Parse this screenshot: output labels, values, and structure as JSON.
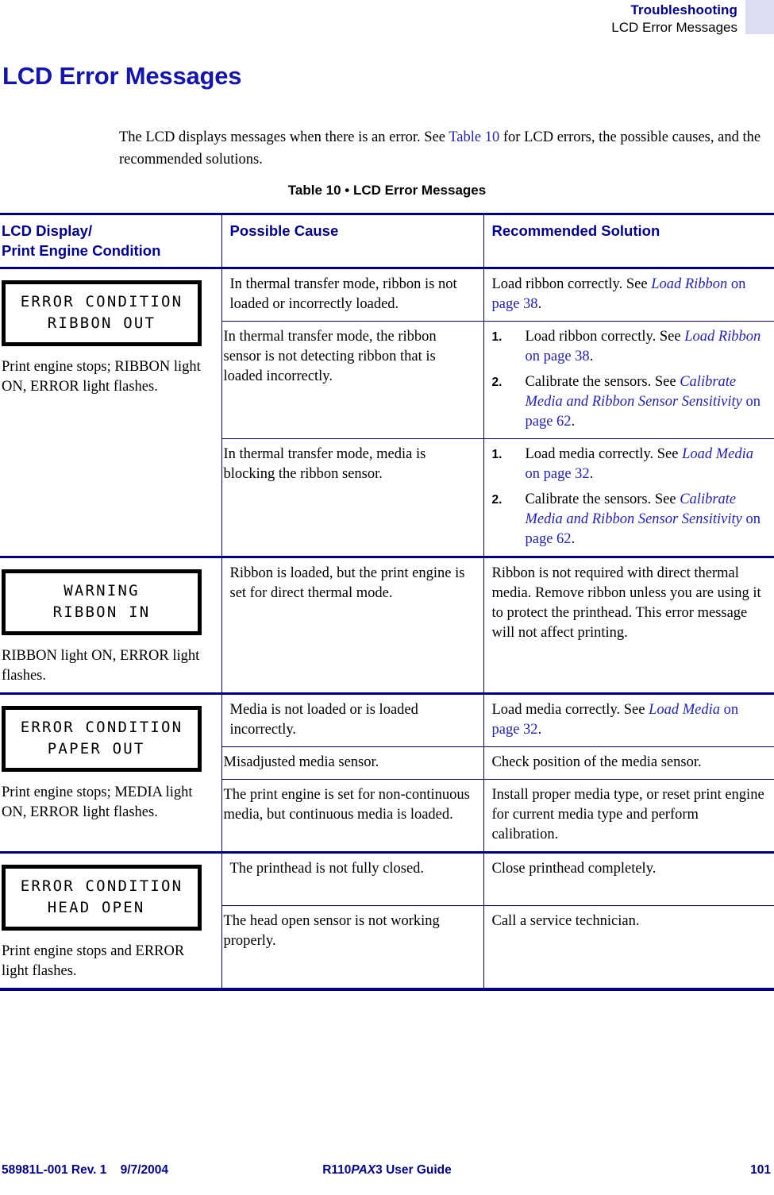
{
  "header": {
    "chapter": "Troubleshooting",
    "section": "LCD Error Messages",
    "swatch_color": "#dcdcf5"
  },
  "title": "LCD Error Messages",
  "intro": {
    "part1": "The LCD displays messages when there is an error. See ",
    "link": "Table 10",
    "part2": " for LCD errors, the possible causes, and the recommended solutions."
  },
  "table": {
    "caption": "Table 10 • LCD Error Messages",
    "columns": [
      "LCD Display/\nPrint Engine Condition",
      "Possible Cause",
      "Recommended Solution"
    ],
    "col_header_line1": "LCD Display/",
    "col_header_line2": "Print Engine Condition",
    "col_header_2": "Possible Cause",
    "col_header_3": "Recommended Solution",
    "groups": [
      {
        "lcd_line1": "ERROR CONDITION",
        "lcd_line2": "  RIBBON OUT  ",
        "condition": "Print engine stops; RIBBON light ON, ERROR light flashes.",
        "rows": [
          {
            "cause": "In thermal transfer mode, ribbon is not loaded or incorrectly loaded.",
            "solution_kind": "text",
            "solution_pre": "Load ribbon correctly. See ",
            "solution_link_italic": "Load Ribbon",
            "solution_link_page": " on page 38",
            "solution_post": "."
          },
          {
            "cause": "In thermal transfer mode, the ribbon sensor is not detecting ribbon that is loaded incorrectly.",
            "solution_kind": "steps",
            "steps": [
              {
                "pre": "Load ribbon correctly. See ",
                "link_italic": "Load Ribbon",
                "link_page": " on page 38",
                "post": "."
              },
              {
                "pre": "Calibrate the sensors. See ",
                "link_italic": "Calibrate Media and Ribbon Sensor Sensitivity",
                "link_page": " on page 62",
                "post": "."
              }
            ]
          },
          {
            "cause": "In thermal transfer mode, media is blocking the ribbon sensor.",
            "solution_kind": "steps",
            "steps": [
              {
                "pre": "Load media correctly. See ",
                "link_italic": "Load Media",
                "link_page": " on page 32",
                "post": "."
              },
              {
                "pre": "Calibrate the sensors. See ",
                "link_italic": "Calibrate Media and Ribbon Sensor Sensitivity",
                "link_page": " on page 62",
                "post": "."
              }
            ]
          }
        ]
      },
      {
        "lcd_line1": "   WARNING   ",
        "lcd_line2": "  RIBBON IN  ",
        "condition": "RIBBON light ON, ERROR light flashes.",
        "rows": [
          {
            "cause": "Ribbon is loaded, but the print engine is set for direct thermal mode.",
            "solution_kind": "text",
            "solution_pre": "Ribbon is not required with direct thermal media. Remove ribbon unless you are using it to protect the printhead. This error message will not affect printing.",
            "solution_link_italic": "",
            "solution_link_page": "",
            "solution_post": ""
          }
        ]
      },
      {
        "lcd_line1": "ERROR CONDITION",
        "lcd_line2": "  PAPER OUT   ",
        "condition": "Print engine stops; MEDIA light ON, ERROR light flashes.",
        "rows": [
          {
            "cause": "Media is not loaded or is loaded incorrectly.",
            "solution_kind": "text",
            "solution_pre": "Load media correctly. See ",
            "solution_link_italic": "Load Media",
            "solution_link_page": " on page 32",
            "solution_post": "."
          },
          {
            "cause": "Misadjusted media sensor.",
            "solution_kind": "text",
            "solution_pre": "Check position of the media sensor.",
            "solution_link_italic": "",
            "solution_link_page": "",
            "solution_post": ""
          },
          {
            "cause": "The print engine is set for non-continuous media, but continuous media is loaded.",
            "solution_kind": "text",
            "solution_pre": "Install proper media type, or reset print engine for current media type and perform calibration.",
            "solution_link_italic": "",
            "solution_link_page": "",
            "solution_post": ""
          }
        ]
      },
      {
        "lcd_line1": "ERROR CONDITION",
        "lcd_line2": "  HEAD OPEN   ",
        "condition": "Print engine stops and ERROR light flashes.",
        "rows": [
          {
            "cause": "The printhead is not fully closed.",
            "solution_kind": "text",
            "solution_pre": "Close printhead completely.",
            "solution_link_italic": "",
            "solution_link_page": "",
            "solution_post": ""
          },
          {
            "cause": "The head open sensor is not working properly.",
            "solution_kind": "text",
            "solution_pre": "Call a service technician.",
            "solution_link_italic": "",
            "solution_link_page": "",
            "solution_post": ""
          }
        ]
      }
    ]
  },
  "footer": {
    "doc_number": "58981L-001 Rev. 1",
    "date": "9/7/2004",
    "guide_pre": "R110",
    "guide_italic": "PAX",
    "guide_post": "3 User Guide",
    "page_number": "101"
  },
  "colors": {
    "heading_blue": "#1414b4",
    "link_blue": "#2020cc",
    "rule_blue": "#00008f",
    "header_blue": "#00009c"
  }
}
